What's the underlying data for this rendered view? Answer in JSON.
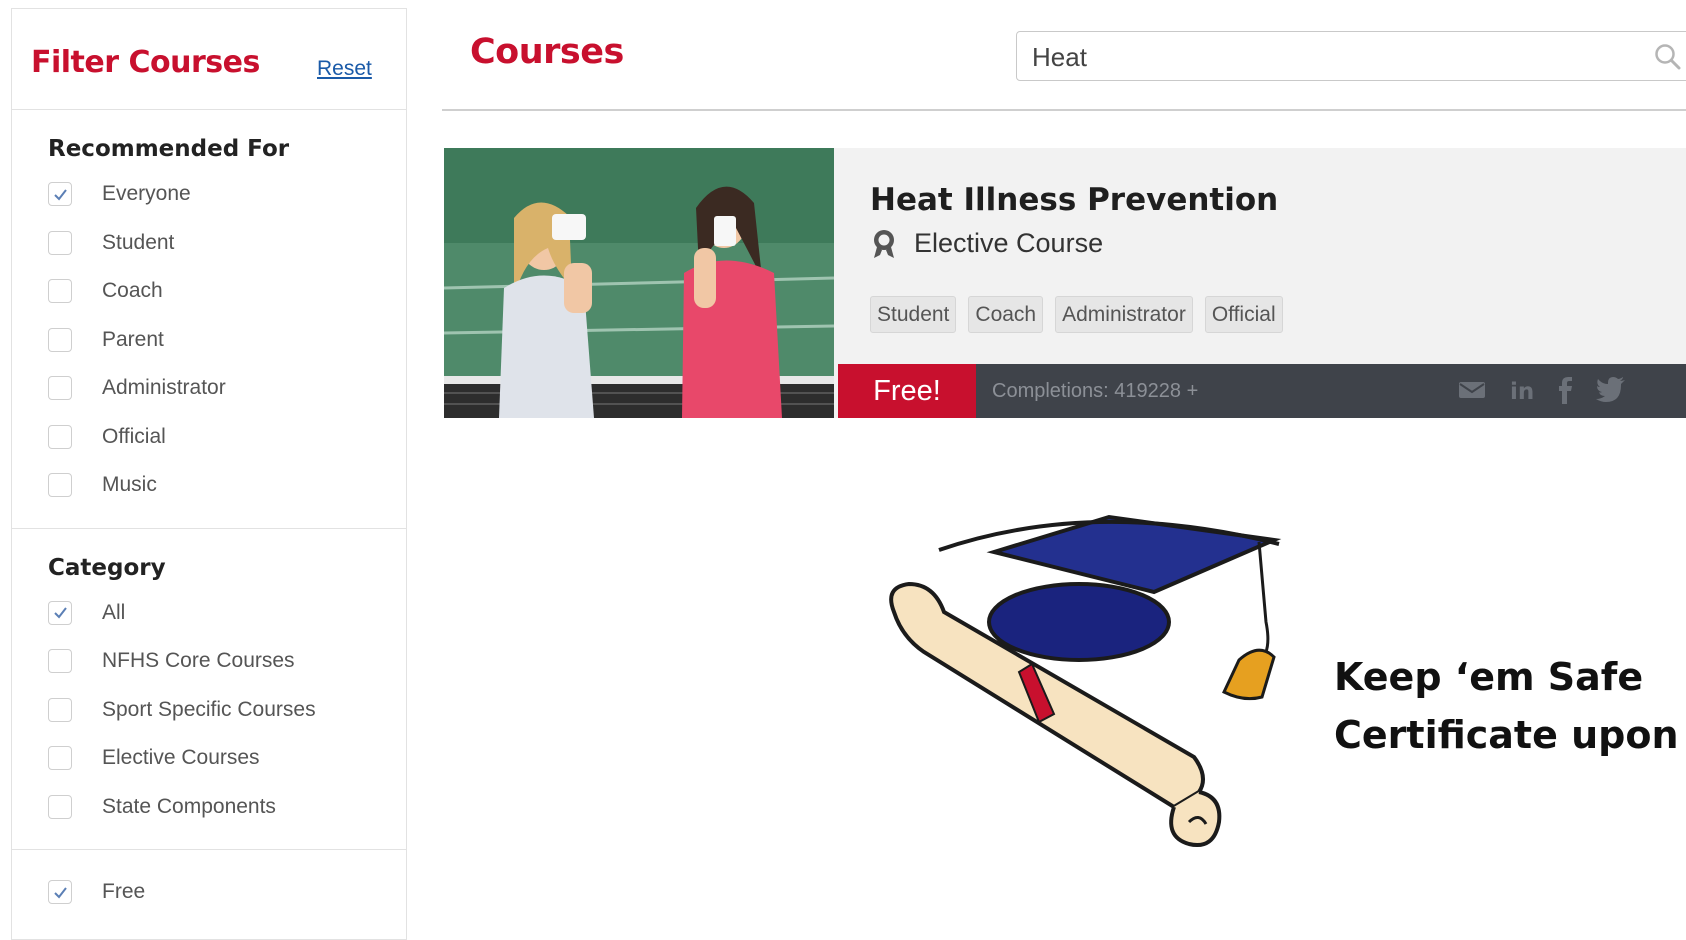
{
  "sidebar": {
    "title": "Filter Courses",
    "reset_label": "Reset",
    "recommended": {
      "heading": "Recommended For",
      "options": [
        {
          "label": "Everyone",
          "checked": true
        },
        {
          "label": "Student",
          "checked": false
        },
        {
          "label": "Coach",
          "checked": false
        },
        {
          "label": "Parent",
          "checked": false
        },
        {
          "label": "Administrator",
          "checked": false
        },
        {
          "label": "Official",
          "checked": false
        },
        {
          "label": "Music",
          "checked": false
        }
      ]
    },
    "category": {
      "heading": "Category",
      "options": [
        {
          "label": "All",
          "checked": true
        },
        {
          "label": "NFHS Core Courses",
          "checked": false
        },
        {
          "label": "Sport Specific Courses",
          "checked": false
        },
        {
          "label": "Elective Courses",
          "checked": false
        },
        {
          "label": "State Components",
          "checked": false
        }
      ]
    },
    "price": {
      "options": [
        {
          "label": "Free",
          "checked": true
        }
      ]
    }
  },
  "main": {
    "title": "Courses",
    "search": {
      "value": "Heat",
      "icon": "search-icon"
    },
    "course": {
      "title": "Heat Illness Prevention",
      "type": "Elective Course",
      "type_icon": "award-ribbon-icon",
      "tags": [
        "Student",
        "Coach",
        "Administrator",
        "Official"
      ],
      "price_badge": "Free!",
      "completions": "Completions: 419228 +",
      "share_icons": [
        "email-icon",
        "linkedin-icon",
        "facebook-icon",
        "twitter-icon"
      ]
    }
  },
  "caption": {
    "line1": "Keep ‘em Safe",
    "line2": "Certificate upon c"
  },
  "colors": {
    "brand_red": "#c8102e",
    "card_bar": "#3f434a",
    "card_bg": "#f2f2f2",
    "cap_blue": "#1a237e"
  }
}
